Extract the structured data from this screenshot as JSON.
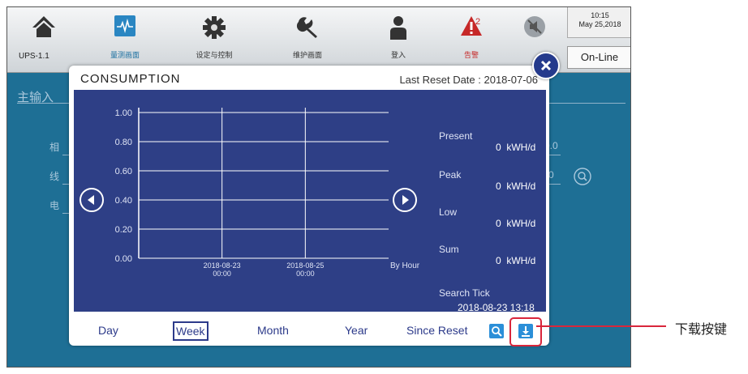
{
  "topbar": {
    "ups_id": "UPS-1.1",
    "nav": [
      {
        "label": "",
        "icon": "home-icon"
      },
      {
        "label": "量测画面",
        "icon": "waveform-icon"
      },
      {
        "label": "设定与控制",
        "icon": "gear-icon"
      },
      {
        "label": "维护画面",
        "icon": "wrench-icon"
      },
      {
        "label": "登入",
        "icon": "user-icon"
      },
      {
        "label": "告警",
        "icon": "alarm-icon",
        "badge": "2"
      },
      {
        "label": "",
        "icon": "mute-icon"
      }
    ],
    "clock_time": "10:15",
    "clock_date": "May 25,2018",
    "status": "On-Line"
  },
  "background": {
    "title": "主输入",
    "row_chars": [
      "相",
      "线",
      "电"
    ],
    "values": [
      "0.0",
      "0"
    ]
  },
  "modal": {
    "title": "CONSUMPTION",
    "reset_date": "Last Reset Date : 2018-07-06",
    "by_hour": "By Hour",
    "stats": [
      {
        "label": "Present",
        "value": "0",
        "unit": "kWH/d"
      },
      {
        "label": "Peak",
        "value": "0",
        "unit": "kWH/d"
      },
      {
        "label": "Low",
        "value": "0",
        "unit": "kWH/d"
      },
      {
        "label": "Sum",
        "value": "0",
        "unit": "kWH/d"
      }
    ],
    "search_tick_label": "Search Tick",
    "search_tick_time": "2018-08-23 13:18",
    "tabs": [
      "Day",
      "Week",
      "Month",
      "Year",
      "Since Reset"
    ],
    "selected_tab": "Week"
  },
  "chart_data": {
    "type": "line",
    "y_ticks": [
      "1.00",
      "0.80",
      "0.60",
      "0.40",
      "0.20",
      "0.00"
    ],
    "ylim": [
      0,
      1
    ],
    "x_ticks": [
      {
        "date": "2018-08-23",
        "time": "00:00"
      },
      {
        "date": "2018-08-25",
        "time": "00:00"
      }
    ],
    "series": [],
    "grid": true
  },
  "callout": {
    "text": "下载按键"
  },
  "colors": {
    "screen_bg": "#1e6f95",
    "chart_bg": "#2e3f86",
    "accent": "#2b8fd8",
    "highlight": "#d9263b"
  }
}
